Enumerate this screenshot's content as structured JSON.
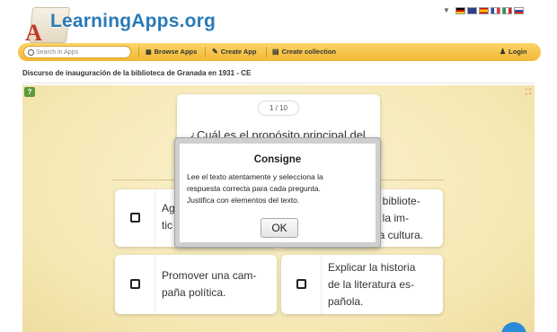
{
  "header": {
    "logo_text": "LearningApps.org",
    "languages": [
      "de",
      "en",
      "es",
      "fr",
      "it",
      "ru"
    ]
  },
  "toolbar": {
    "search_placeholder": "Search in Apps",
    "browse_label": "Browse Apps",
    "create_label": "Create App",
    "collection_label": "Create collection",
    "login_label": "Login"
  },
  "page": {
    "title": "Discurso de inauguración de la biblioteca de Granada en 1931 - CE"
  },
  "quiz": {
    "counter": "1 / 10",
    "question": "¿Cuál es el propósito principal del",
    "answers": [
      {
        "text": "Ag\ntic"
      },
      {
        "text": "na bibliote-\nde la im-\ne la cultura."
      },
      {
        "text": "Promover una cam-\npaña política."
      },
      {
        "text": "Explicar la historia\nde la literatura es-\npañola."
      }
    ]
  },
  "modal": {
    "title": "Consigne",
    "text": "Lee el texto atentamente y selecciona la\nrespuesta correcta para cada pregunta.\nJustifica con elementos del texto.",
    "ok_label": "OK"
  },
  "colors": {
    "brand_blue": "#2a7ab8",
    "toolbar_yellow": "#f2b733",
    "app_background": "#f5e8b4"
  }
}
